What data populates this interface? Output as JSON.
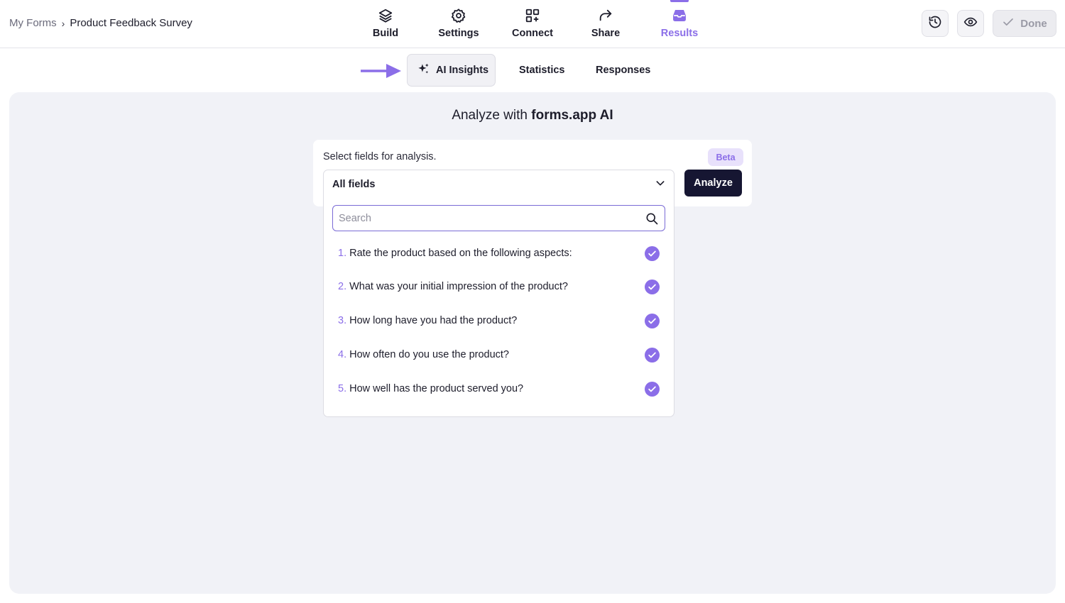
{
  "breadcrumb": {
    "root": "My Forms",
    "separator": "›",
    "current": "Product Feedback Survey"
  },
  "nav": {
    "items": [
      {
        "label": "Build",
        "icon": "layers-icon"
      },
      {
        "label": "Settings",
        "icon": "gear-icon"
      },
      {
        "label": "Connect",
        "icon": "grid-plus-icon"
      },
      {
        "label": "Share",
        "icon": "share-arrow-icon"
      },
      {
        "label": "Results",
        "icon": "inbox-icon",
        "active": true
      }
    ]
  },
  "actions": {
    "history_icon": "history-icon",
    "preview_icon": "eye-icon",
    "done_label": "Done"
  },
  "subtabs": [
    {
      "label": "AI Insights",
      "icon": "sparkles-icon",
      "active": true
    },
    {
      "label": "Statistics"
    },
    {
      "label": "Responses"
    }
  ],
  "main": {
    "title_prefix": "Analyze with ",
    "title_brand": "forms.app AI",
    "field_label": "Select fields for analysis.",
    "beta_badge": "Beta",
    "analyze_label": "Analyze",
    "dropdown": {
      "selected": "All fields",
      "search_placeholder": "Search",
      "options": [
        {
          "num": "1.",
          "text": "Rate the product based on the following aspects:",
          "checked": true
        },
        {
          "num": "2.",
          "text": "What was your initial impression of the product?",
          "checked": true
        },
        {
          "num": "3.",
          "text": "How long have you had the product?",
          "checked": true
        },
        {
          "num": "4.",
          "text": "How often do you use the product?",
          "checked": true
        },
        {
          "num": "5.",
          "text": "How well has the product served you?",
          "checked": true
        }
      ]
    }
  },
  "colors": {
    "accent": "#8b6ee8",
    "dark_button": "#161632",
    "panel_bg": "#f1f2f7"
  }
}
